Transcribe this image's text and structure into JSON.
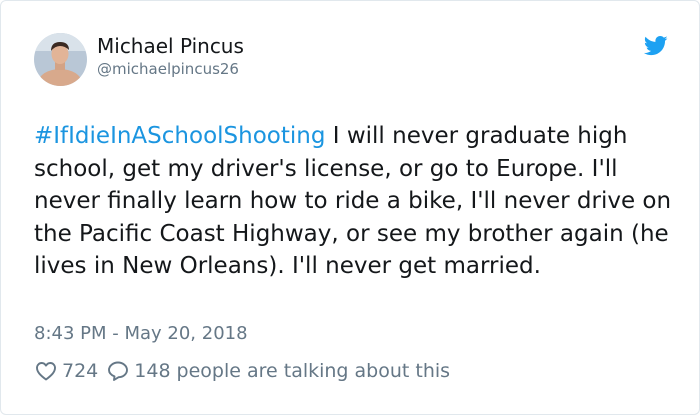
{
  "author": {
    "name": "Michael Pincus",
    "handle": "@michaelpincus26"
  },
  "tweet": {
    "hashtag": "#IfIdieInASchoolShooting",
    "text": " I will never graduate high school, get my driver's license, or go to Europe. I'll never finally learn how to ride a bike, I'll never drive on the Pacific Coast Highway, or see my brother again (he lives in New Orleans). I'll never get married.",
    "timestamp": "8:43 PM - May 20, 2018"
  },
  "engagement": {
    "likes": "724",
    "replies": "148",
    "talking_label": "people are talking about this"
  },
  "icons": {
    "brand": "twitter-bird-icon",
    "like": "heart-icon",
    "reply": "speech-bubble-icon"
  },
  "colors": {
    "hashtag": "#1b95e0",
    "twitter_blue": "#1da1f2",
    "secondary_text": "#657786",
    "primary_text": "#14171a"
  }
}
